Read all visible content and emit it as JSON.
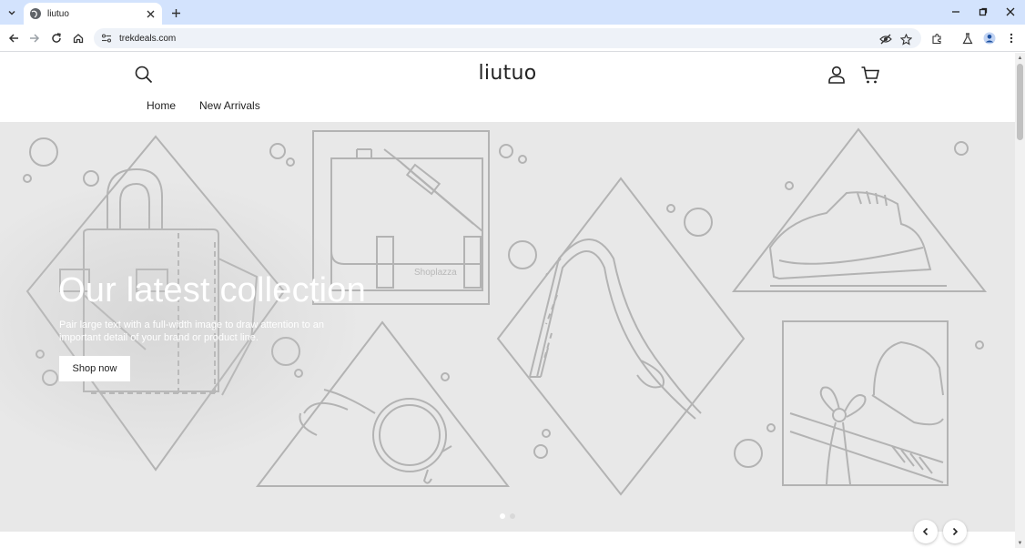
{
  "browser": {
    "tab": {
      "title": "liutuo"
    },
    "address_bar": {
      "url": "trekdeals.com"
    }
  },
  "site": {
    "logo": "liutuo",
    "nav": [
      {
        "label": "Home"
      },
      {
        "label": "New Arrivals"
      }
    ]
  },
  "hero": {
    "heading": "Our latest collection",
    "subheading": "Pair large text with a full-width image to draw attention to an important detail of your brand or product line.",
    "button_label": "Shop now",
    "watermark": "Shoplazza",
    "slide_count": 2,
    "active_slide": 1
  },
  "colors": {
    "tabbar": "#d3e3fd",
    "hero_bg": "#e8e8e8",
    "line_art": "#b3b3b3"
  },
  "icons": [
    "search-icon",
    "account-icon",
    "cart-icon",
    "chevron-left-icon",
    "chevron-right-icon"
  ]
}
